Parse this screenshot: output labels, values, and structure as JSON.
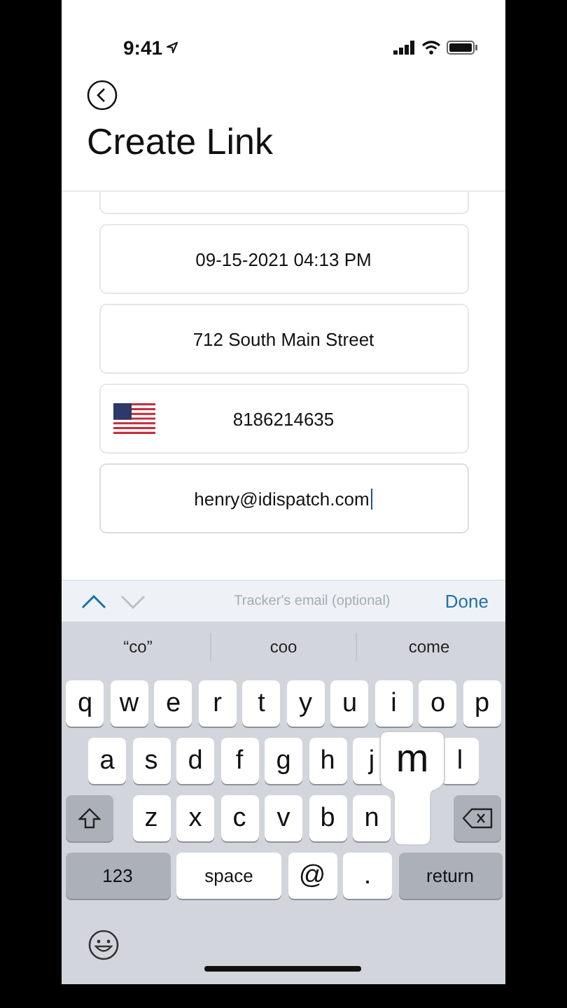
{
  "status_bar": {
    "time": "9:41"
  },
  "header": {
    "title": "Create Link"
  },
  "fields": [
    {
      "kind": "text",
      "value": "09-15-2021 04:13 PM",
      "focused": false
    },
    {
      "kind": "text",
      "value": "712 South Main Street",
      "focused": false
    },
    {
      "kind": "phone",
      "value": "8186214635",
      "focused": false
    },
    {
      "kind": "text",
      "value": "henry@idispatch.com",
      "focused": true
    }
  ],
  "accessory_bar": {
    "previous_disabled": false,
    "next_disabled": true,
    "hint": "Tracker's email (optional)",
    "done": "Done"
  },
  "suggestions": [
    "“co”",
    "coo",
    "come"
  ],
  "keyboard": {
    "pressed_key": "m",
    "letter_rows": [
      [
        {
          "kind": "letter",
          "label": "q"
        },
        {
          "kind": "letter",
          "label": "w"
        },
        {
          "kind": "letter",
          "label": "e"
        },
        {
          "kind": "letter",
          "label": "r"
        },
        {
          "kind": "letter",
          "label": "t"
        },
        {
          "kind": "letter",
          "label": "y"
        },
        {
          "kind": "letter",
          "label": "u"
        },
        {
          "kind": "letter",
          "label": "i"
        },
        {
          "kind": "letter",
          "label": "o"
        },
        {
          "kind": "letter",
          "label": "p"
        }
      ],
      [
        {
          "kind": "letter",
          "label": "a"
        },
        {
          "kind": "letter",
          "label": "s"
        },
        {
          "kind": "letter",
          "label": "d"
        },
        {
          "kind": "letter",
          "label": "f"
        },
        {
          "kind": "letter",
          "label": "g"
        },
        {
          "kind": "letter",
          "label": "h"
        },
        {
          "kind": "letter",
          "label": "j"
        },
        {
          "kind": "covered"
        },
        {
          "kind": "letter",
          "label": "l"
        }
      ],
      [
        {
          "kind": "shift"
        },
        {
          "kind": "letter",
          "label": "z"
        },
        {
          "kind": "letter",
          "label": "x"
        },
        {
          "kind": "letter",
          "label": "c"
        },
        {
          "kind": "letter",
          "label": "v"
        },
        {
          "kind": "letter",
          "label": "b"
        },
        {
          "kind": "letter",
          "label": "n"
        },
        {
          "kind": "covered"
        },
        {
          "kind": "delete"
        }
      ]
    ],
    "bottom_row": [
      {
        "kind": "mode",
        "label": "123"
      },
      {
        "kind": "space",
        "label": "space"
      },
      {
        "kind": "symbol",
        "label": "@"
      },
      {
        "kind": "symbol",
        "label": "."
      },
      {
        "kind": "return",
        "label": "return"
      }
    ]
  }
}
